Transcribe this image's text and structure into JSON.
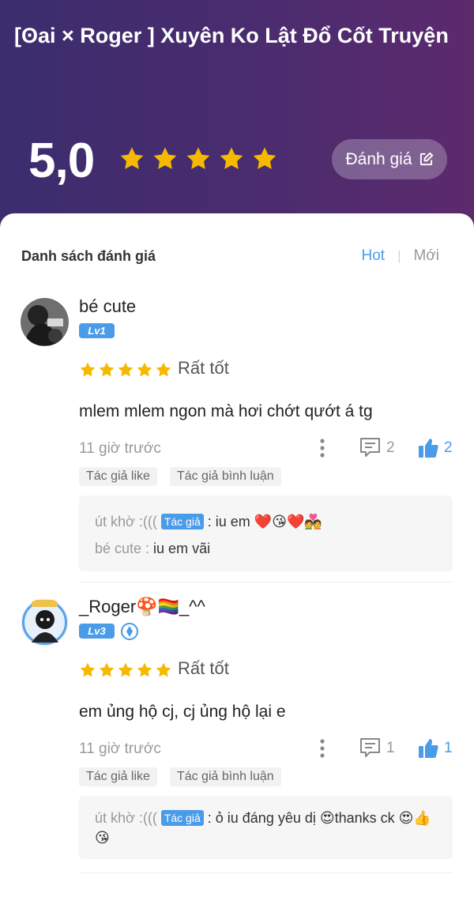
{
  "header": {
    "title": "[ʘai × Roger ] Xuyên Ko Lật Đổ Cốt Truyện",
    "score": "5,0",
    "rate_button": "Đánh giá"
  },
  "list": {
    "heading": "Danh sách đánh giá",
    "sort_hot": "Hot",
    "sort_new": "Mới"
  },
  "reviews": [
    {
      "name": "bé cute",
      "level": "Lv1",
      "rating_label": "Rất tốt",
      "content": "mlem mlem ngon mà hơi chớt qướt á tg",
      "time": "11 giờ trước",
      "comments": "2",
      "likes": "2",
      "tags": [
        "Tác giả like",
        "Tác giả bình luận"
      ],
      "replies": [
        {
          "who": "út khờ :(((",
          "author_tag": "Tác giả",
          "text": ": iu em ❤️😘❤️💑"
        },
        {
          "who": "bé cute :",
          "text": " iu em vãi"
        }
      ]
    },
    {
      "name": "_Roger🍄🏳️‍🌈_^^",
      "level": "Lv3",
      "rating_label": "Rất tốt",
      "content": "em ủng hộ cj, cj ủng hộ lại e",
      "time": "11 giờ trước",
      "comments": "1",
      "likes": "1",
      "tags": [
        "Tác giả like",
        "Tác giả bình luận"
      ],
      "replies": [
        {
          "who": "út khờ :(((",
          "author_tag": "Tác giả",
          "text": ": ỏ iu đáng yêu dị 😍thanks ck 😍👍😘"
        }
      ]
    }
  ],
  "colors": {
    "accent": "#4a9be8",
    "star": "#f5b900",
    "header_start": "#3b2d6e",
    "header_end": "#5c2a6d"
  },
  "icons": [
    "star-icon",
    "edit-icon",
    "more-icon",
    "comment-icon",
    "thumbs-up-icon",
    "badge-icon"
  ]
}
